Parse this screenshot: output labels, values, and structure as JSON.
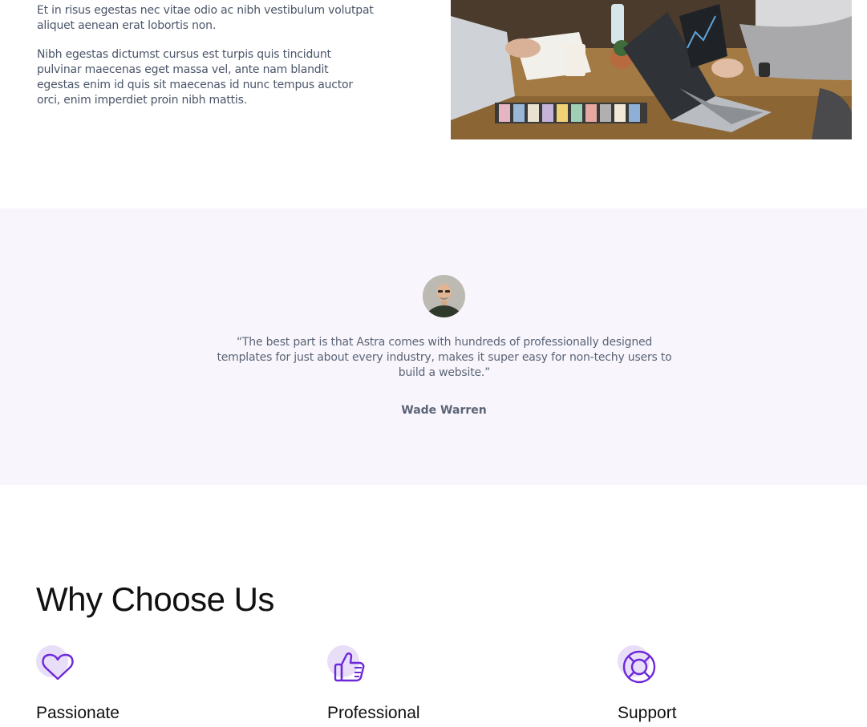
{
  "intro": {
    "paragraphs": [
      "Et in risus egestas nec vitae odio ac nibh vestibulum volutpat aliquet aenean erat lobortis non.",
      "Nibh egestas dictumst cursus est turpis quis tincidunt pulvinar maecenas eget massa vel, ante nam blandit egestas enim id quis sit maecenas id nunc tempus auctor orci, enim imperdiet proin nibh mattis."
    ]
  },
  "testimonial": {
    "quote": "“The best part is that Astra comes with hundreds of professionally designed templates for just about every industry, makes it super easy for non-techy users to build a website.”",
    "author": "Wade Warren",
    "background": "#f8f6fc"
  },
  "why_choose_us": {
    "title": "Why Choose Us",
    "features": [
      {
        "label": "Passionate",
        "icon": "heart-icon"
      },
      {
        "label": "Professional",
        "icon": "thumbs-up-icon"
      },
      {
        "label": "Support",
        "icon": "lifebuoy-icon"
      }
    ]
  },
  "colors": {
    "accent": "#6d28d9",
    "icon_blob": "#e9def8",
    "body_text": "#4a5568",
    "heading": "#111111"
  }
}
